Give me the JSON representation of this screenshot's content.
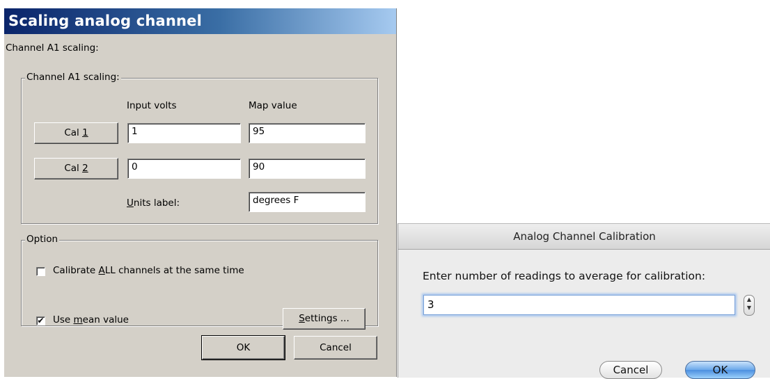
{
  "scaling_dialog": {
    "title": "Scaling analog channel",
    "heading": "Channel A1 scaling:",
    "group_title": "Channel A1 scaling:",
    "col_input_volts": "Input volts",
    "col_map_value": "Map value",
    "cal1": {
      "button_prefix": "Cal ",
      "button_key": "1",
      "input_volts": "1",
      "map_value": "95"
    },
    "cal2": {
      "button_prefix": "Cal ",
      "button_key": "2",
      "input_volts": "0",
      "map_value": "90"
    },
    "units_label_key": "U",
    "units_label_rest": "nits label:",
    "units_value": "degrees F",
    "option_group_title": "Option",
    "calibrate_all": {
      "prefix": "Calibrate ",
      "key": "A",
      "suffix": "LL channels at the same time",
      "checked": false
    },
    "use_mean": {
      "prefix": "Use ",
      "key": "m",
      "suffix": "ean value",
      "checked": true,
      "check_glyph": "✔"
    },
    "settings_key": "S",
    "settings_rest": "ettings ...",
    "ok_label": "OK",
    "cancel_label": "Cancel"
  },
  "calibration_dialog": {
    "title": "Analog Channel Calibration",
    "prompt": "Enter number of readings to average for calibration:",
    "readings_value": "3",
    "stepper_up": "▲",
    "stepper_down": "▼",
    "cancel_label": "Cancel",
    "ok_label": "OK"
  }
}
